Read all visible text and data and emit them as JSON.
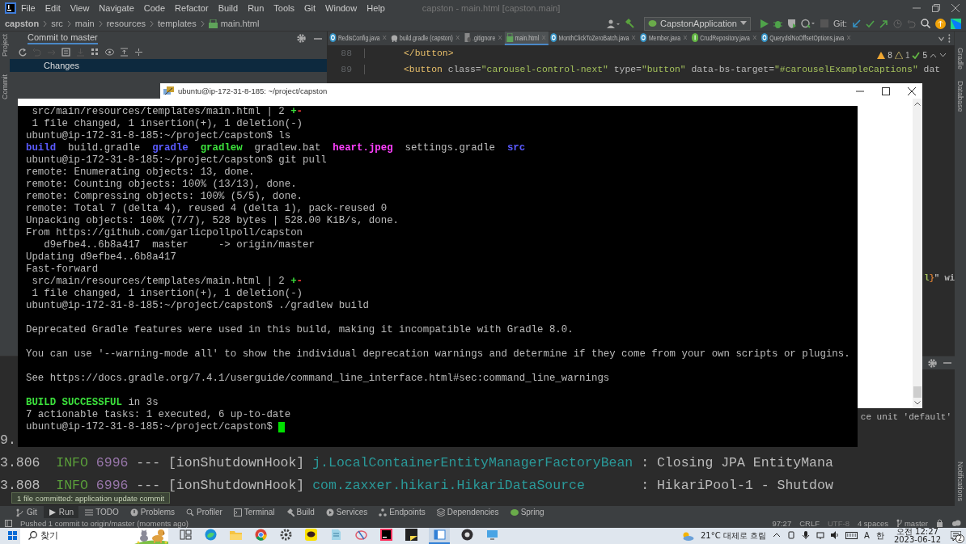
{
  "ide": {
    "menu": [
      "File",
      "Edit",
      "View",
      "Navigate",
      "Code",
      "Refactor",
      "Build",
      "Run",
      "Tools",
      "Git",
      "Window",
      "Help"
    ],
    "title": "capston - main.html [capston.main]",
    "breadcrumb": [
      "capston",
      "src",
      "main",
      "resources",
      "templates",
      "main.html"
    ],
    "run_config": "CapstonApplication",
    "git_label": "Git:",
    "left_stripe": [
      "Project",
      "Commit"
    ],
    "right_stripe": [
      "Gradle",
      "Database",
      "Notifications"
    ],
    "commit_panel": {
      "title": "Commit to master",
      "items": [
        {
          "label": "Changes",
          "selected": true
        }
      ]
    },
    "tabs": [
      {
        "label": "RedisConfig.java",
        "kind": "class",
        "selected": false
      },
      {
        "label": "build.gradle (capston)",
        "kind": "gradle",
        "selected": false
      },
      {
        "label": ".gitignore",
        "kind": "gitignore",
        "selected": false
      },
      {
        "label": "main.html",
        "kind": "html",
        "selected": true
      },
      {
        "label": "MonthClickToZeroBatch.java",
        "kind": "class",
        "selected": false
      },
      {
        "label": "Member.java",
        "kind": "class",
        "selected": false
      },
      {
        "label": "CrudRepository.java",
        "kind": "interface",
        "selected": false
      },
      {
        "label": "QuerydslNoOffsetOptions.java",
        "kind": "class",
        "selected": false
      }
    ],
    "inspections": [
      {
        "kind": "warning",
        "count": "8"
      },
      {
        "kind": "weak",
        "count": "1"
      },
      {
        "kind": "ok",
        "count": "5"
      }
    ],
    "editor_lines": [
      {
        "number": "88",
        "segments": [
          {
            "text": "</button>",
            "color": "#e8bf6a"
          }
        ]
      },
      {
        "number": "89",
        "segments": [
          {
            "text": "<button",
            "color": "#e8bf6a"
          },
          {
            "text": " class=",
            "color": "#bababa"
          },
          {
            "text": "\"carousel-control-next\"",
            "color": "#a5c25c"
          },
          {
            "text": " type=",
            "color": "#bababa"
          },
          {
            "text": "\"button\"",
            "color": "#a5c25c"
          },
          {
            "text": " data-bs-target=",
            "color": "#bababa"
          },
          {
            "text": "\"#carouselExampleCaptions\"",
            "color": "#a5c25c"
          },
          {
            "text": " dat",
            "color": "#bababa"
          }
        ]
      }
    ],
    "editor_fragment": [
      {
        "text": "l",
        "color": "#a5c25c"
      },
      {
        "text": "}",
        "color": "#cc7832"
      },
      {
        "text": "\" wi",
        "color": "#bababa"
      }
    ],
    "console_lines": [
      {
        "kind": "tail",
        "segments": [
          {
            "text": "ce unit 'default'"
          }
        ]
      },
      {
        "kind": "log",
        "segments": [
          {
            "text": "9."
          }
        ]
      },
      {
        "kind": "log",
        "segments": [
          {
            "text": "3.806  "
          },
          {
            "text": "INFO ",
            "color": "#5a9e3a"
          },
          {
            "text": "6996",
            "color": "#9876aa"
          },
          {
            "text": " --- [ionShutdownHook] "
          },
          {
            "text": "j.LocalContainerEntityManagerFactoryBean",
            "color": "#2a9a9a"
          },
          {
            "text": " : Closing JPA EntityMana"
          }
        ]
      },
      {
        "kind": "log",
        "segments": [
          {
            "text": "3.808  "
          },
          {
            "text": "INFO ",
            "color": "#5a9e3a"
          },
          {
            "text": "6996",
            "color": "#9876aa"
          },
          {
            "text": " --- [ionShutdownHook] "
          },
          {
            "text": "com.zaxxer.hikari.HikariDataSource",
            "color": "#2a9a9a"
          },
          {
            "text": "       : HikariPool-1 - Shutdow"
          }
        ]
      }
    ],
    "tool_tabs": [
      {
        "label": "Git",
        "selected": false
      },
      {
        "label": "Run",
        "selected": true
      },
      {
        "label": "TODO",
        "selected": false
      },
      {
        "label": "Problems",
        "selected": false
      },
      {
        "label": "Profiler",
        "selected": false
      },
      {
        "label": "Terminal",
        "selected": false
      },
      {
        "label": "Build",
        "selected": false
      },
      {
        "label": "Services",
        "selected": false
      },
      {
        "label": "Endpoints",
        "selected": false
      },
      {
        "label": "Dependencies",
        "selected": false
      },
      {
        "label": "Spring",
        "selected": false
      }
    ],
    "tooltip": "1 file committed: application update commit",
    "status": {
      "message": "Pushed 1 commit to origin/master (moments ago)",
      "position": "97:27",
      "line_separator": "CRLF",
      "encoding": "UTF-8",
      "indent": "4 spaces",
      "branch": "master"
    }
  },
  "terminal": {
    "title": "ubuntu@ip-172-31-8-185: ~/project/capston",
    "lines": [
      {
        "kind": "text",
        "segments": [
          {
            "text": " src/main/resources/templates/main.html | 2 "
          },
          {
            "text": "+",
            "color": "#3ce13c"
          },
          {
            "text": "-",
            "color": "#ff4040"
          }
        ]
      },
      {
        "kind": "text",
        "segments": [
          {
            "text": " 1 file changed, 1 insertion(+), 1 deletion(-)"
          }
        ]
      },
      {
        "kind": "text",
        "segments": [
          {
            "text": "ubuntu@ip-172-31-8-185:~/project/capston$ ls"
          }
        ]
      },
      {
        "kind": "text",
        "segments": [
          {
            "text": "build  ",
            "color": "#5a5aff"
          },
          {
            "text": "build.gradle  "
          },
          {
            "text": "gradle  ",
            "color": "#5a5aff"
          },
          {
            "text": "gradlew  ",
            "color": "#3ce13c"
          },
          {
            "text": "gradlew.bat  "
          },
          {
            "text": "heart.jpeg  ",
            "color": "#ff40ff"
          },
          {
            "text": "settings.gradle  "
          },
          {
            "text": "src",
            "color": "#5a5aff"
          }
        ]
      },
      {
        "kind": "text",
        "segments": [
          {
            "text": "ubuntu@ip-172-31-8-185:~/project/capston$ git pull"
          }
        ]
      },
      {
        "kind": "text",
        "segments": [
          {
            "text": "remote: Enumerating objects: 13, done."
          }
        ]
      },
      {
        "kind": "text",
        "segments": [
          {
            "text": "remote: Counting objects: 100% (13/13), done."
          }
        ]
      },
      {
        "kind": "text",
        "segments": [
          {
            "text": "remote: Compressing objects: 100% (5/5), done."
          }
        ]
      },
      {
        "kind": "text",
        "segments": [
          {
            "text": "remote: Total 7 (delta 4), reused 4 (delta 1), pack-reused 0"
          }
        ]
      },
      {
        "kind": "text",
        "segments": [
          {
            "text": "Unpacking objects: 100% (7/7), 528 bytes | 528.00 KiB/s, done."
          }
        ]
      },
      {
        "kind": "text",
        "segments": [
          {
            "text": "From https://github.com/garlicpollpoll/capston"
          }
        ]
      },
      {
        "kind": "text",
        "segments": [
          {
            "text": "   d9efbe4..6b8a417  master     -> origin/master"
          }
        ]
      },
      {
        "kind": "text",
        "segments": [
          {
            "text": "Updating d9efbe4..6b8a417"
          }
        ]
      },
      {
        "kind": "text",
        "segments": [
          {
            "text": "Fast-forward"
          }
        ]
      },
      {
        "kind": "text",
        "segments": [
          {
            "text": " src/main/resources/templates/main.html | 2 "
          },
          {
            "text": "+",
            "color": "#3ce13c"
          },
          {
            "text": "-",
            "color": "#ff4040"
          }
        ]
      },
      {
        "kind": "text",
        "segments": [
          {
            "text": " 1 file changed, 1 insertion(+), 1 deletion(-)"
          }
        ]
      },
      {
        "kind": "text",
        "segments": [
          {
            "text": "ubuntu@ip-172-31-8-185:~/project/capston$ ./gradlew build"
          }
        ]
      },
      {
        "kind": "blank"
      },
      {
        "kind": "text",
        "segments": [
          {
            "text": "Deprecated Gradle features were used in this build, making it incompatible with Gradle 8.0."
          }
        ]
      },
      {
        "kind": "blank"
      },
      {
        "kind": "text",
        "segments": [
          {
            "text": "You can use '--warning-mode all' to show the individual deprecation warnings and determine if they come from your own scripts or plugins."
          }
        ]
      },
      {
        "kind": "blank"
      },
      {
        "kind": "text",
        "segments": [
          {
            "text": "See https://docs.gradle.org/7.4.1/userguide/command_line_interface.html#sec:command_line_warnings"
          }
        ]
      },
      {
        "kind": "blank"
      },
      {
        "kind": "text",
        "segments": [
          {
            "text": "BUILD SUCCESSFUL",
            "color": "#3ce13c"
          },
          {
            "text": " in 3s"
          }
        ]
      },
      {
        "kind": "text",
        "segments": [
          {
            "text": "7 actionable tasks: 1 executed, 6 up-to-date"
          }
        ]
      },
      {
        "kind": "cursor",
        "segments": [
          {
            "text": "ubuntu@ip-172-31-8-185:~/project/capston$ "
          }
        ]
      }
    ]
  },
  "taskbar": {
    "search": {
      "placeholder": "찾기"
    },
    "apps": [
      {
        "kind": "taskview",
        "selected": false
      },
      {
        "kind": "edge",
        "selected": false
      },
      {
        "kind": "explorer",
        "selected": false
      },
      {
        "kind": "chrome",
        "selected": false
      },
      {
        "kind": "settings",
        "selected": false
      },
      {
        "kind": "chat",
        "selected": false
      },
      {
        "kind": "notepad",
        "selected": false
      },
      {
        "kind": "paint",
        "selected": false
      },
      {
        "kind": "ide",
        "selected": false
      },
      {
        "kind": "sticky",
        "selected": false
      },
      {
        "kind": "window",
        "selected": true
      },
      {
        "kind": "obs",
        "selected": false
      },
      {
        "kind": "remote",
        "selected": false
      }
    ],
    "weather": "21°C 대체로 흐림",
    "input_indicators": [
      "A",
      "한"
    ],
    "time": "오전 12:27",
    "date": "2023-06-12",
    "notification_count": "2"
  }
}
